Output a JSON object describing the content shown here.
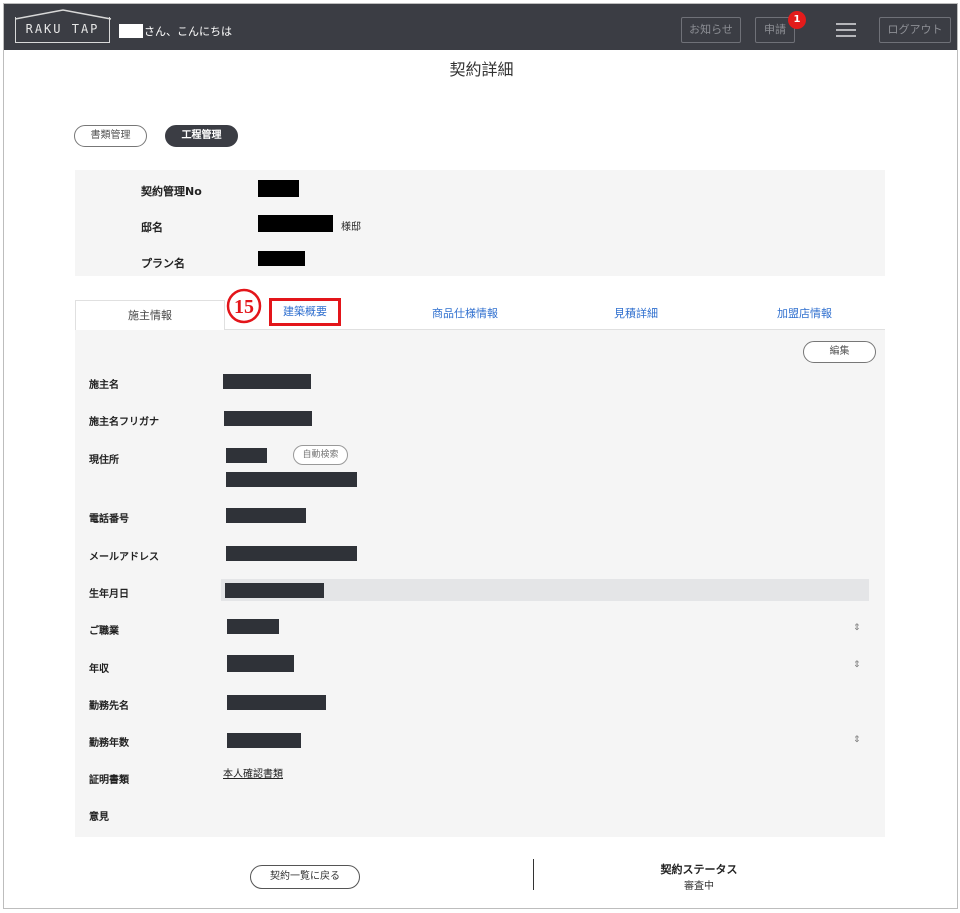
{
  "header": {
    "logo_text": "RAKU TAP",
    "greeting": "さん、こんにちは",
    "notice_label": "お知らせ",
    "apply_label": "申請",
    "apply_badge": "1",
    "logout_label": "ログアウト"
  },
  "page_title": "契約詳細",
  "top_tabs": {
    "docs": "書類管理",
    "process": "工程管理"
  },
  "summary": {
    "contract_no_label": "契約管理No",
    "residence_label": "邸名",
    "residence_suffix": "様邸",
    "plan_label": "プラン名"
  },
  "detail_tabs": {
    "owner": "施主情報",
    "building": "建築概要",
    "product": "商品仕様情報",
    "estimate": "見積詳細",
    "dealer": "加盟店情報"
  },
  "annotation_number": "15",
  "form": {
    "edit_label": "編集",
    "auto_search_label": "自動検索",
    "fields": {
      "owner_name": "施主名",
      "owner_kana": "施主名フリガナ",
      "address": "現住所",
      "phone": "電話番号",
      "email": "メールアドレス",
      "birthday": "生年月日",
      "occupation": "ご職業",
      "income": "年収",
      "employer": "勤務先名",
      "years_employed": "勤務年数",
      "proof_docs": "証明書類",
      "opinion": "意見"
    },
    "proof_docs_link": "本人確認書類"
  },
  "footer": {
    "back_label": "契約一覧に戻る",
    "status_label": "契約ステータス",
    "status_value": "審査中"
  },
  "colors": {
    "header_bg": "#3b3d44",
    "accent_link": "#2f6fcf",
    "highlight_red": "#e3151a",
    "badge_red": "#e31b1b"
  }
}
